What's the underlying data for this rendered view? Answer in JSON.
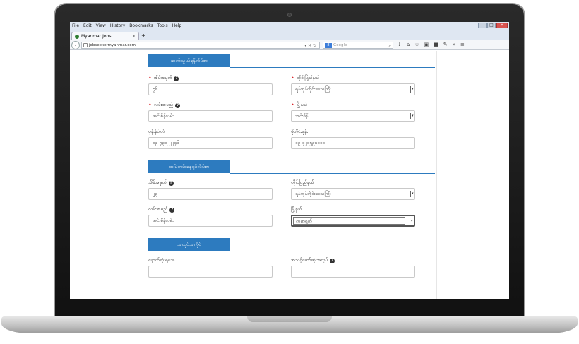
{
  "browser": {
    "menu": [
      "File",
      "Edit",
      "View",
      "History",
      "Bookmarks",
      "Tools",
      "Help"
    ],
    "tab_title": "Myanmar Jobs",
    "tab_close": "×",
    "new_tab": "+",
    "url": "jobseekermyanmar.com",
    "search_engine_label": "8",
    "search_placeholder": "Google"
  },
  "form": {
    "sections": {
      "contact": "ဆက်သွယ်ရန်လိပ်စာ",
      "current": "အမြဲတမ်းနေရပ်လိပ်စာ",
      "job": "အလုပ်အကိုင်"
    },
    "contact": {
      "house_label": "အိမ်အမှတ်",
      "house_value": "၇၆",
      "region_label": "တိုင်းပြည်နယ်",
      "region_value": "ရန်ကုန်တိုင်းဒေသကြီး",
      "street_label": "လမ်းအမည်",
      "street_value": "အင်းစိန်လမ်း",
      "township_label": "မြို့နယ်",
      "township_value": "အင်းစိန်",
      "phone_label": "ဖုန်းနံပါတ်",
      "phone_value": "၀၉-၇၃၁၂၂၂၄၆",
      "home_phone_label": "မိုဘိုင်းဖုန်း",
      "home_phone_value": "၀၉-၄၂၀၅၉၈၀၀၀"
    },
    "current": {
      "house_label": "အိမ်အမှတ်",
      "house_value": "၂၃",
      "region_label": "တိုင်းပြည်နယ်",
      "region_value": "ရန်ကုန်တိုင်းဒေသကြီး",
      "street_label": "လမ်းအမည်",
      "street_value": "အင်းစိန်လမ်း",
      "township_label": "မြို့နယ်",
      "township_value": "ကမာရွတ်"
    },
    "job": {
      "left_label": "နောက်ဆုံးရလခ",
      "right_label": "အသင့်တော်ဆုံးအလုပ်"
    },
    "help_glyph": "?",
    "required_glyph": "•",
    "arrow_glyph": "▾"
  }
}
